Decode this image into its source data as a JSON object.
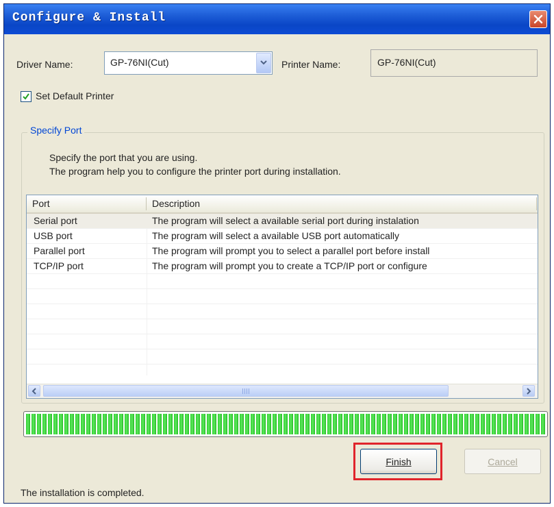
{
  "window": {
    "title": "Configure & Install"
  },
  "driver": {
    "label": "Driver Name:",
    "value": "GP-76NI(Cut)"
  },
  "printer": {
    "label": "Printer Name:",
    "value": "GP-76NI(Cut)"
  },
  "default_printer": {
    "label": "Set Default Printer",
    "checked": true
  },
  "port_group": {
    "title": "Specify Port",
    "line1": "Specify the port that you are using.",
    "line2": "The program help you to configure the printer port during installation."
  },
  "table": {
    "columns": [
      "Port",
      "Description"
    ],
    "rows": [
      [
        "Serial port",
        "The program will select a available serial port during instalation"
      ],
      [
        "USB port",
        "The program will select a available USB port automatically"
      ],
      [
        "Parallel port",
        "The program will prompt you to select a parallel port before install"
      ],
      [
        "TCP/IP port",
        "The program will prompt you to create a TCP/IP port or configure"
      ]
    ],
    "selected_row": 0
  },
  "progress": {
    "percent": 100
  },
  "buttons": {
    "finish": "Finish",
    "cancel": "Cancel"
  },
  "status": "The installation is completed.",
  "colors": {
    "title_bar": "#0A46C6",
    "progress": "#2FD02F",
    "highlight": "#E0242B"
  }
}
